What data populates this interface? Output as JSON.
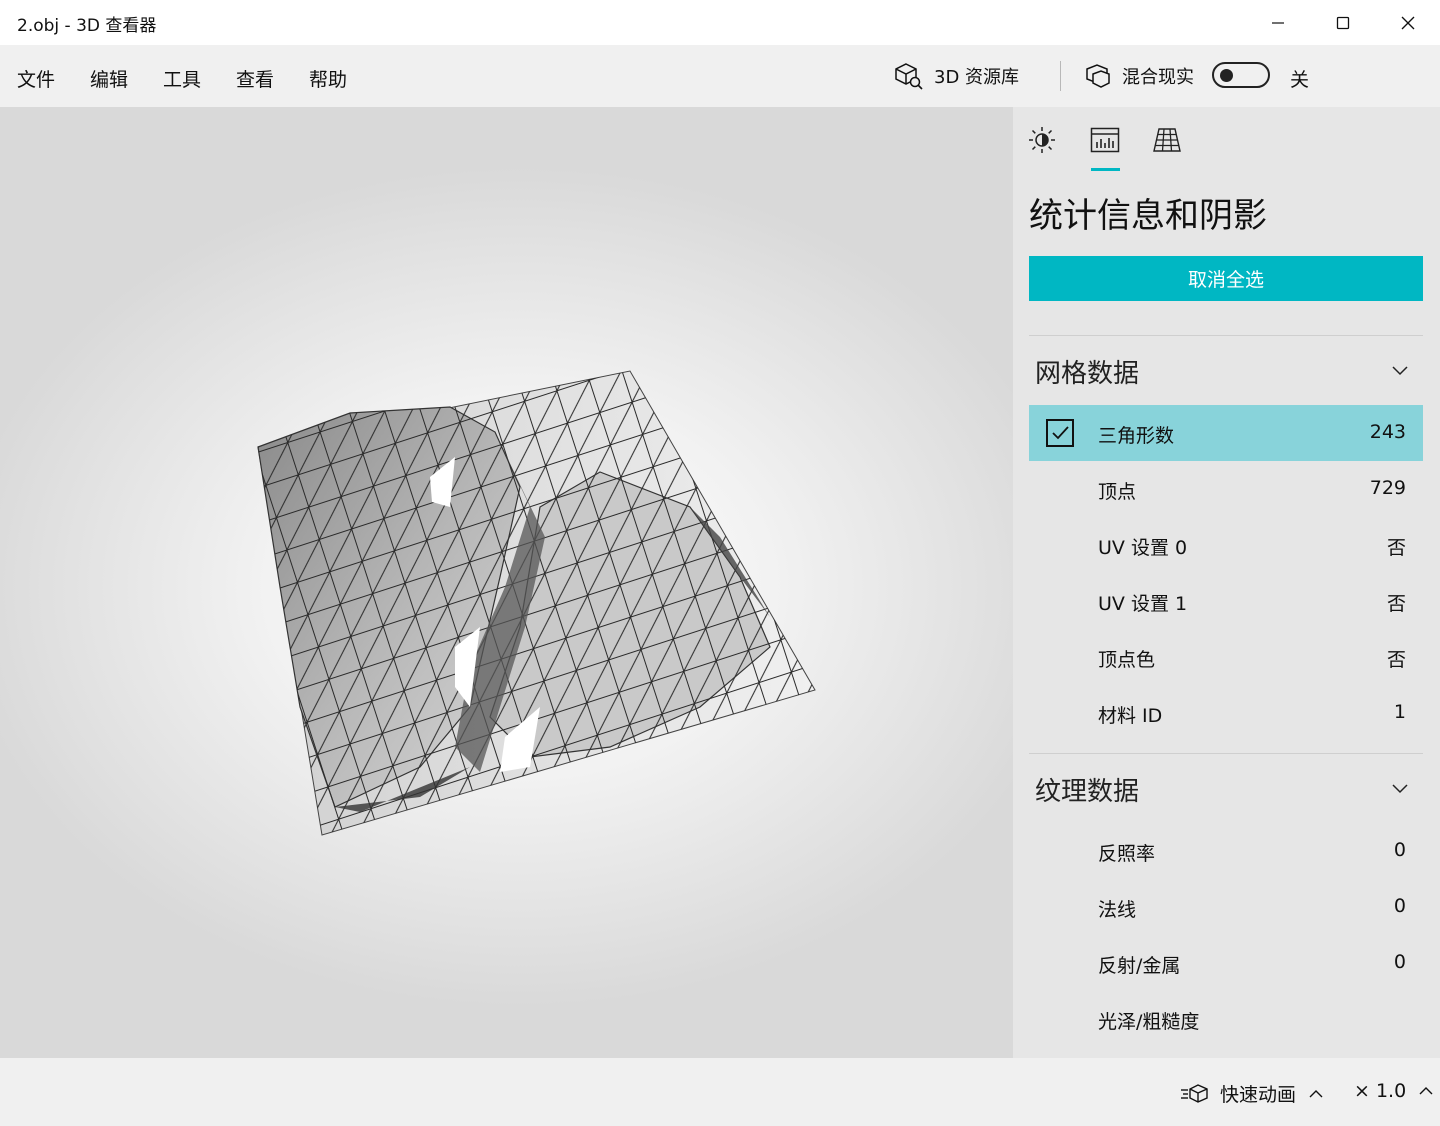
{
  "window": {
    "title": "2.obj - 3D 查看器"
  },
  "menu": {
    "items": [
      "文件",
      "编辑",
      "工具",
      "查看",
      "帮助"
    ],
    "library_label": "3D 资源库",
    "mixed_reality_label": "混合现实",
    "toggle_state": "关"
  },
  "panel": {
    "title": "统计信息和阴影",
    "deselect_label": "取消全选",
    "mesh_section": {
      "label": "网格数据",
      "rows": [
        {
          "name": "三角形数",
          "value": "243",
          "selected": true
        },
        {
          "name": "顶点",
          "value": "729"
        },
        {
          "name": "UV 设置 0",
          "value": "否"
        },
        {
          "name": "UV 设置 1",
          "value": "否"
        },
        {
          "name": "顶点色",
          "value": "否"
        },
        {
          "name": "材料 ID",
          "value": "1"
        }
      ]
    },
    "texture_section": {
      "label": "纹理数据",
      "rows": [
        {
          "name": "反照率",
          "value": "0"
        },
        {
          "name": "法线",
          "value": "0"
        },
        {
          "name": "反射/金属",
          "value": "0"
        },
        {
          "name": "光泽/粗糙度",
          "value": ""
        }
      ]
    }
  },
  "status": {
    "animation_label": "快速动画",
    "speed": "× 1.0"
  },
  "colors": {
    "accent": "#00b7c3",
    "selected_row": "#88d3da"
  }
}
